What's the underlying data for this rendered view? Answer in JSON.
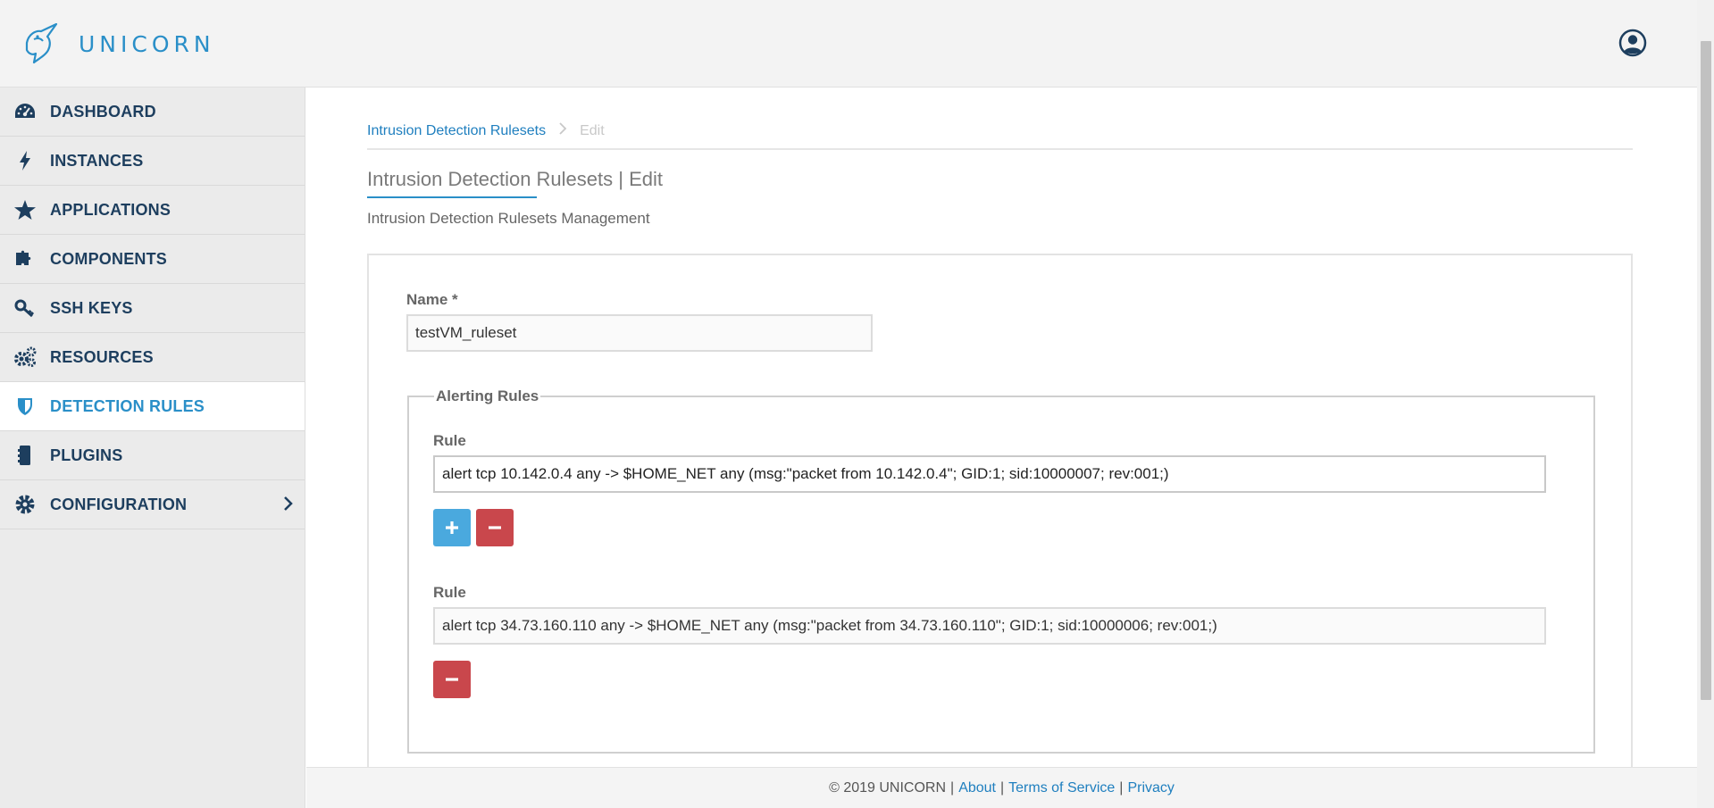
{
  "brand": {
    "name": "UNICORN"
  },
  "sidebar": {
    "items": [
      {
        "label": "DASHBOARD",
        "icon": "dashboard-gauge-icon"
      },
      {
        "label": "INSTANCES",
        "icon": "lightning-bolt-icon"
      },
      {
        "label": "APPLICATIONS",
        "icon": "star-icon"
      },
      {
        "label": "COMPONENTS",
        "icon": "puzzle-piece-icon"
      },
      {
        "label": "SSH KEYS",
        "icon": "key-icon"
      },
      {
        "label": "RESOURCES",
        "icon": "gears-icon"
      },
      {
        "label": "DETECTION RULES",
        "icon": "shield-icon",
        "active": true
      },
      {
        "label": "PLUGINS",
        "icon": "plugin-icon"
      },
      {
        "label": "CONFIGURATION",
        "icon": "gear-icon",
        "has_submenu": true
      }
    ]
  },
  "breadcrumb": {
    "link": "Intrusion Detection Rulesets",
    "current": "Edit"
  },
  "page": {
    "title": "Intrusion Detection Rulesets | Edit",
    "subtitle": "Intrusion Detection Rulesets Management"
  },
  "form": {
    "name_label": "Name *",
    "name_value": "testVM_ruleset",
    "alerting_legend": "Alerting Rules",
    "rules": [
      {
        "label": "Rule",
        "value": "alert tcp 10.142.0.4 any -> $HOME_NET any (msg:\"packet from 10.142.0.4\"; GID:1; sid:10000007; rev:001;)",
        "focused": true
      },
      {
        "label": "Rule",
        "value": "alert tcp 34.73.160.110 any -> $HOME_NET any (msg:\"packet from 34.73.160.110\"; GID:1; sid:10000006; rev:001;)",
        "focused": false
      }
    ],
    "add_glyph": "+",
    "remove_glyph": "−"
  },
  "footer": {
    "copyright": "© 2019 UNICORN",
    "about": "About",
    "terms": "Terms of Service",
    "privacy": "Privacy",
    "separator": "|"
  },
  "colors": {
    "accent": "#2a8fc8",
    "nav_text": "#1d3e5e",
    "add_button": "#4aa9de",
    "remove_button": "#c9474c",
    "sidebar_bg": "#ebebeb",
    "header_bg": "#f3f3f3"
  }
}
